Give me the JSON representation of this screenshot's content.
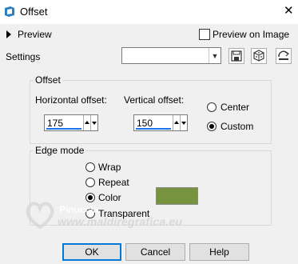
{
  "window": {
    "title": "Offset",
    "close_glyph": "✕"
  },
  "preview": {
    "label": "Preview",
    "on_image_label": "Preview on Image",
    "on_image_checked": false
  },
  "settings": {
    "label": "Settings",
    "combo_value": ""
  },
  "offset": {
    "group_label": "Offset",
    "horizontal_label": "Horizontal offset:",
    "horizontal_value": "175",
    "vertical_label": "Vertical offset:",
    "vertical_value": "150",
    "center_label": "Center",
    "custom_label": "Custom",
    "selected": "Custom"
  },
  "edge_mode": {
    "group_label": "Edge mode",
    "options": [
      "Wrap",
      "Repeat",
      "Color",
      "Transparent"
    ],
    "selected": "Color",
    "color": "#78933f"
  },
  "buttons": {
    "ok": "OK",
    "cancel": "Cancel",
    "help": "Help"
  },
  "watermark": {
    "line1": "Pinuccia",
    "line2": "www.maldiregrafica.eu"
  },
  "colors": {
    "accent": "#0078d7",
    "titlebar": "#ffffff",
    "dialog": "#f0f0f0"
  }
}
